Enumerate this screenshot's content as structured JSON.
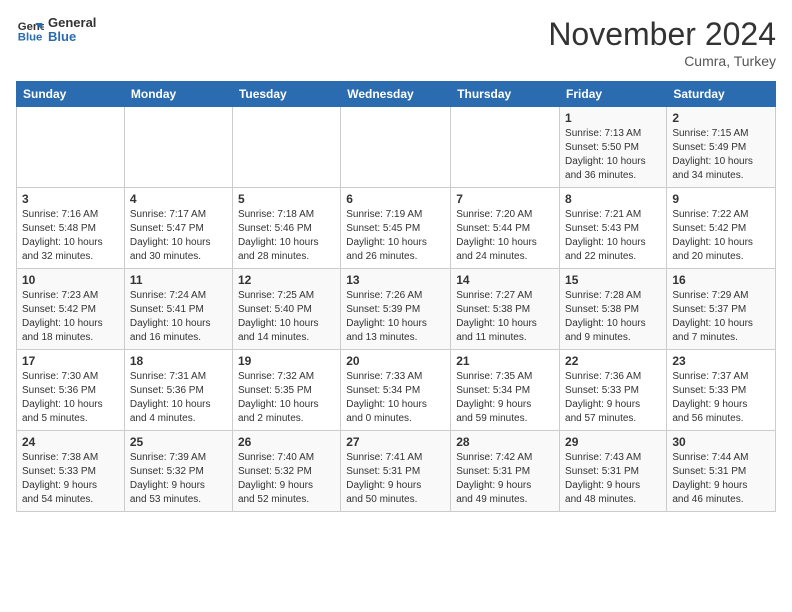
{
  "header": {
    "logo_line1": "General",
    "logo_line2": "Blue",
    "title": "November 2024",
    "subtitle": "Cumra, Turkey"
  },
  "weekdays": [
    "Sunday",
    "Monday",
    "Tuesday",
    "Wednesday",
    "Thursday",
    "Friday",
    "Saturday"
  ],
  "weeks": [
    [
      {
        "day": "",
        "detail": ""
      },
      {
        "day": "",
        "detail": ""
      },
      {
        "day": "",
        "detail": ""
      },
      {
        "day": "",
        "detail": ""
      },
      {
        "day": "",
        "detail": ""
      },
      {
        "day": "1",
        "detail": "Sunrise: 7:13 AM\nSunset: 5:50 PM\nDaylight: 10 hours\nand 36 minutes."
      },
      {
        "day": "2",
        "detail": "Sunrise: 7:15 AM\nSunset: 5:49 PM\nDaylight: 10 hours\nand 34 minutes."
      }
    ],
    [
      {
        "day": "3",
        "detail": "Sunrise: 7:16 AM\nSunset: 5:48 PM\nDaylight: 10 hours\nand 32 minutes."
      },
      {
        "day": "4",
        "detail": "Sunrise: 7:17 AM\nSunset: 5:47 PM\nDaylight: 10 hours\nand 30 minutes."
      },
      {
        "day": "5",
        "detail": "Sunrise: 7:18 AM\nSunset: 5:46 PM\nDaylight: 10 hours\nand 28 minutes."
      },
      {
        "day": "6",
        "detail": "Sunrise: 7:19 AM\nSunset: 5:45 PM\nDaylight: 10 hours\nand 26 minutes."
      },
      {
        "day": "7",
        "detail": "Sunrise: 7:20 AM\nSunset: 5:44 PM\nDaylight: 10 hours\nand 24 minutes."
      },
      {
        "day": "8",
        "detail": "Sunrise: 7:21 AM\nSunset: 5:43 PM\nDaylight: 10 hours\nand 22 minutes."
      },
      {
        "day": "9",
        "detail": "Sunrise: 7:22 AM\nSunset: 5:42 PM\nDaylight: 10 hours\nand 20 minutes."
      }
    ],
    [
      {
        "day": "10",
        "detail": "Sunrise: 7:23 AM\nSunset: 5:42 PM\nDaylight: 10 hours\nand 18 minutes."
      },
      {
        "day": "11",
        "detail": "Sunrise: 7:24 AM\nSunset: 5:41 PM\nDaylight: 10 hours\nand 16 minutes."
      },
      {
        "day": "12",
        "detail": "Sunrise: 7:25 AM\nSunset: 5:40 PM\nDaylight: 10 hours\nand 14 minutes."
      },
      {
        "day": "13",
        "detail": "Sunrise: 7:26 AM\nSunset: 5:39 PM\nDaylight: 10 hours\nand 13 minutes."
      },
      {
        "day": "14",
        "detail": "Sunrise: 7:27 AM\nSunset: 5:38 PM\nDaylight: 10 hours\nand 11 minutes."
      },
      {
        "day": "15",
        "detail": "Sunrise: 7:28 AM\nSunset: 5:38 PM\nDaylight: 10 hours\nand 9 minutes."
      },
      {
        "day": "16",
        "detail": "Sunrise: 7:29 AM\nSunset: 5:37 PM\nDaylight: 10 hours\nand 7 minutes."
      }
    ],
    [
      {
        "day": "17",
        "detail": "Sunrise: 7:30 AM\nSunset: 5:36 PM\nDaylight: 10 hours\nand 5 minutes."
      },
      {
        "day": "18",
        "detail": "Sunrise: 7:31 AM\nSunset: 5:36 PM\nDaylight: 10 hours\nand 4 minutes."
      },
      {
        "day": "19",
        "detail": "Sunrise: 7:32 AM\nSunset: 5:35 PM\nDaylight: 10 hours\nand 2 minutes."
      },
      {
        "day": "20",
        "detail": "Sunrise: 7:33 AM\nSunset: 5:34 PM\nDaylight: 10 hours\nand 0 minutes."
      },
      {
        "day": "21",
        "detail": "Sunrise: 7:35 AM\nSunset: 5:34 PM\nDaylight: 9 hours\nand 59 minutes."
      },
      {
        "day": "22",
        "detail": "Sunrise: 7:36 AM\nSunset: 5:33 PM\nDaylight: 9 hours\nand 57 minutes."
      },
      {
        "day": "23",
        "detail": "Sunrise: 7:37 AM\nSunset: 5:33 PM\nDaylight: 9 hours\nand 56 minutes."
      }
    ],
    [
      {
        "day": "24",
        "detail": "Sunrise: 7:38 AM\nSunset: 5:33 PM\nDaylight: 9 hours\nand 54 minutes."
      },
      {
        "day": "25",
        "detail": "Sunrise: 7:39 AM\nSunset: 5:32 PM\nDaylight: 9 hours\nand 53 minutes."
      },
      {
        "day": "26",
        "detail": "Sunrise: 7:40 AM\nSunset: 5:32 PM\nDaylight: 9 hours\nand 52 minutes."
      },
      {
        "day": "27",
        "detail": "Sunrise: 7:41 AM\nSunset: 5:31 PM\nDaylight: 9 hours\nand 50 minutes."
      },
      {
        "day": "28",
        "detail": "Sunrise: 7:42 AM\nSunset: 5:31 PM\nDaylight: 9 hours\nand 49 minutes."
      },
      {
        "day": "29",
        "detail": "Sunrise: 7:43 AM\nSunset: 5:31 PM\nDaylight: 9 hours\nand 48 minutes."
      },
      {
        "day": "30",
        "detail": "Sunrise: 7:44 AM\nSunset: 5:31 PM\nDaylight: 9 hours\nand 46 minutes."
      }
    ]
  ]
}
